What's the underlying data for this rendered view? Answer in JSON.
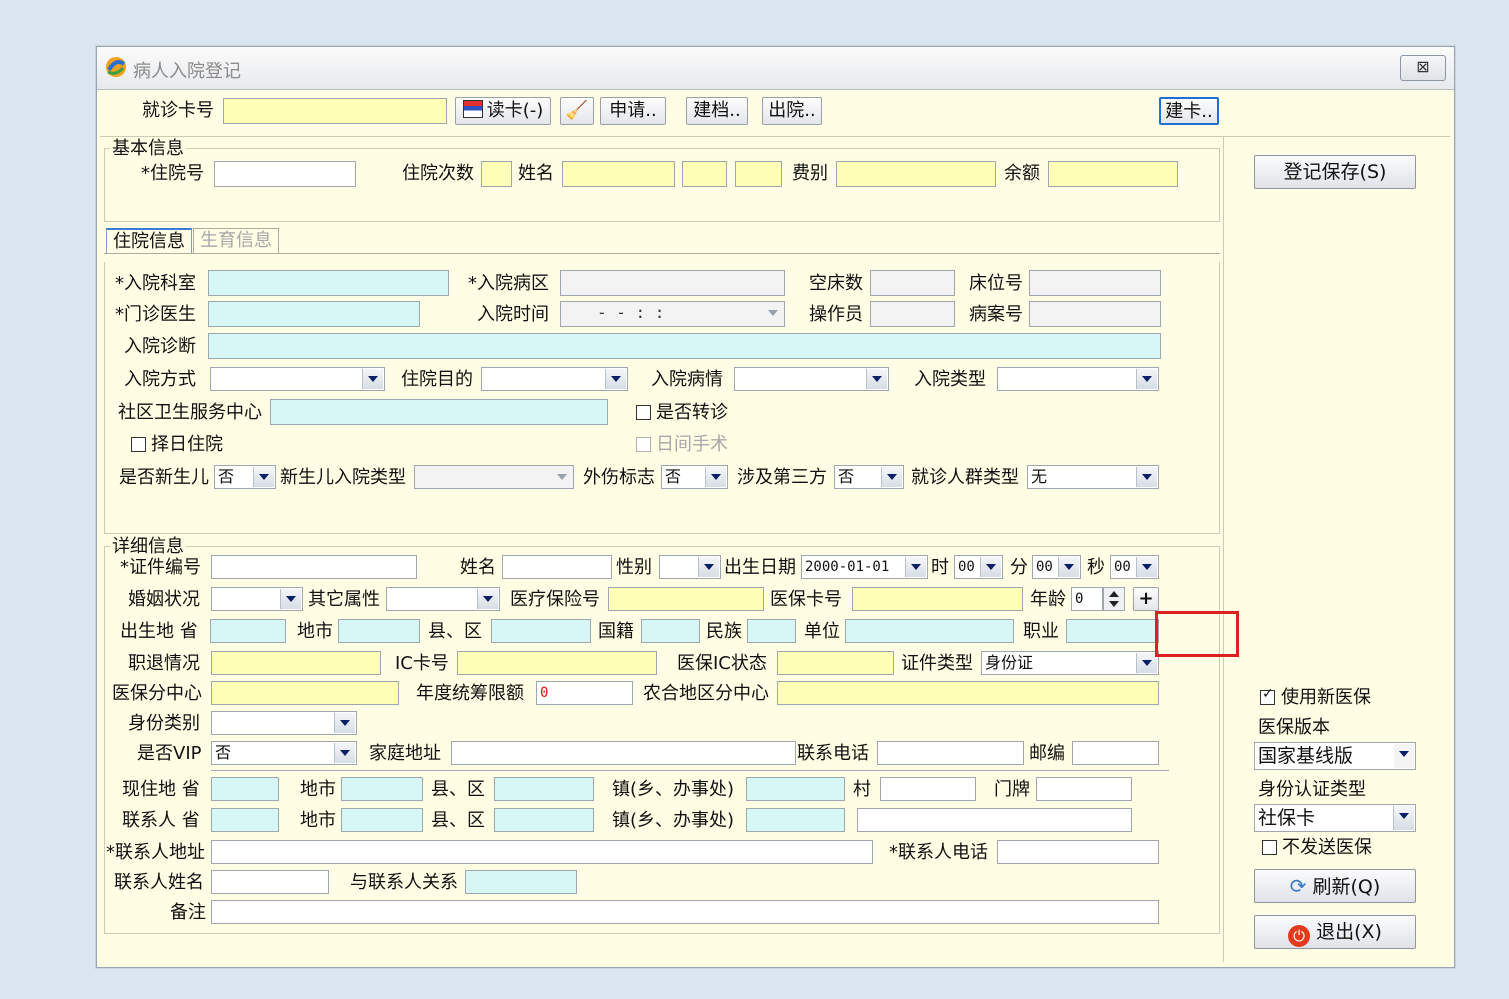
{
  "window": {
    "title": "病人入院登记",
    "close": "⊠"
  },
  "top": {
    "card_label": "就诊卡号",
    "card_value": "",
    "read_card": "读卡(-)",
    "apply": "申请..",
    "archive": "建档..",
    "discharge": "出院..",
    "make_card": "建卡.."
  },
  "basic": {
    "group": "基本信息",
    "inpatient_no": "*住院号",
    "visit_count": "住院次数",
    "name": "姓名",
    "fee_type": "费别",
    "balance": "余额"
  },
  "tabs": {
    "t1": "住院信息",
    "t2": "生育信息"
  },
  "admission": {
    "dept": "*入院科室",
    "ward": "*入院病区",
    "empty_beds": "空床数",
    "bed_no": "床位号",
    "doctor": "*门诊医生",
    "admit_time": "入院时间",
    "admit_time_value": "-  -     :  :",
    "operator": "操作员",
    "case_no": "病案号",
    "diagnosis": "入院诊断",
    "method": "入院方式",
    "purpose": "住院目的",
    "condition": "入院病情",
    "type": "入院类型",
    "community": "社区卫生服务中心",
    "transfer": "是否转诊",
    "scheduled": "择日住院",
    "day_surgery": "日间手术",
    "newborn": "是否新生儿",
    "newborn_value": "否",
    "newborn_type": "新生儿入院类型",
    "trauma": "外伤标志",
    "trauma_value": "否",
    "third_party": "涉及第三方",
    "third_party_value": "否",
    "crowd": "就诊人群类型",
    "crowd_value": "无"
  },
  "detail": {
    "group": "详细信息",
    "id_no": "*证件编号",
    "name": "姓名",
    "sex": "性别",
    "birth": "出生日期",
    "birth_value": "2000-01-01",
    "hour": "时",
    "hour_value": "00",
    "minute": "分",
    "minute_value": "00",
    "second": "秒",
    "second_value": "00",
    "marital": "婚姻状况",
    "other_attr": "其它属性",
    "insurance_no": "医疗保险号",
    "insurance_card": "医保卡号",
    "age": "年龄",
    "age_value": "0",
    "plus": "+",
    "birth_prov": "出生地 省",
    "city": "地市",
    "county": "县、区",
    "nationality": "国籍",
    "ethnic": "民族",
    "employer": "单位",
    "occupation": "职业",
    "retire": "职退情况",
    "ic_card": "IC卡号",
    "ic_status": "医保IC状态",
    "id_type": "证件类型",
    "id_type_value": "身份证",
    "ins_center": "医保分中心",
    "annual_limit": "年度统筹限额",
    "annual_limit_value": "0",
    "rural_center": "农合地区分中心",
    "identity": "身份类别",
    "vip": "是否VIP",
    "vip_value": "否",
    "home_addr": "家庭地址",
    "phone": "联系电话",
    "zip": "邮编",
    "cur_prov": "现住地 省",
    "town": "镇(乡、办事处)",
    "village": "村",
    "house_no": "门牌",
    "contact_prov": "联系人 省",
    "contact_addr": "*联系人地址",
    "contact_phone": "*联系人电话",
    "contact_name": "联系人姓名",
    "relation": "与联系人关系",
    "remark": "备注"
  },
  "side": {
    "save": "登记保存(S)",
    "use_new_ins": "使用新医保",
    "ins_version_label": "医保版本",
    "ins_version": "国家基线版",
    "auth_type_label": "身份认证类型",
    "auth_type": "社保卡",
    "no_send": "不发送医保",
    "refresh": "刷新(Q)",
    "exit": "退出(X)"
  }
}
